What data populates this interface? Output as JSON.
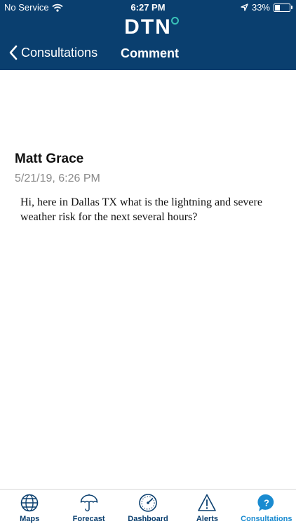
{
  "status_bar": {
    "carrier": "No Service",
    "time": "6:27 PM",
    "battery": "33%",
    "battery_level": 0.33
  },
  "header": {
    "logo": "DTN",
    "back_label": "Consultations",
    "title": "Comment",
    "background_color": "#0a3f6f"
  },
  "comment": {
    "author": "Matt Grace",
    "timestamp": "5/21/19, 6:26 PM",
    "message": "Hi, here in Dallas TX what is the lightning and severe weather risk for the next several hours?"
  },
  "tab_bar": {
    "active_tab": "Consultations",
    "active_color": "#1a8bd0",
    "tabs": [
      {
        "label": "Maps",
        "icon": "globe-icon"
      },
      {
        "label": "Forecast",
        "icon": "umbrella-icon"
      },
      {
        "label": "Dashboard",
        "icon": "gauge-icon"
      },
      {
        "label": "Alerts",
        "icon": "warning-icon"
      },
      {
        "label": "Consultations",
        "icon": "question-icon"
      }
    ]
  }
}
